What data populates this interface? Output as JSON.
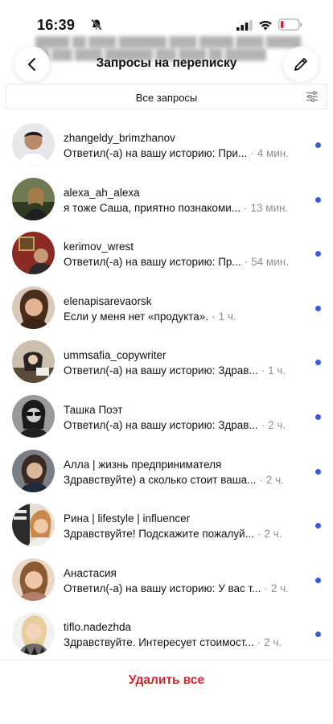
{
  "status_bar": {
    "time": "16:39"
  },
  "header": {
    "title": "Запросы на переписку"
  },
  "filter": {
    "label": "Все запросы"
  },
  "requests": [
    {
      "username": "zhangeldy_brimzhanov",
      "preview": "Ответил(-а) на вашу историю: При...",
      "time": "4 мин.",
      "unread": true
    },
    {
      "username": "alexa_ah_alexa",
      "preview": "я тоже Саша, приятно познакоми...",
      "time": "13 мин.",
      "unread": true
    },
    {
      "username": "kerimov_wrest",
      "preview": "Ответил(-а) на вашу историю: Пр...",
      "time": "54 мин.",
      "unread": true
    },
    {
      "username": "elenapisarevaorsk",
      "preview": "Если у меня нет «продукта».",
      "time": "1 ч.",
      "unread": true
    },
    {
      "username": "ummsafia_copywriter",
      "preview": "Ответил(-а) на вашу историю: Здрав...",
      "time": "1 ч.",
      "unread": true
    },
    {
      "username": "Ташка Поэт",
      "preview": "Ответил(-а) на вашу историю: Здрав...",
      "time": "2 ч.",
      "unread": true
    },
    {
      "username": "Алла | жизнь предпринимателя",
      "preview": "Здравствуйте) а сколько стоит ваша...",
      "time": "2 ч.",
      "unread": true
    },
    {
      "username": "Рина | lifestyle | influencer",
      "preview": "Здравствуйте! Подскажите пожалуй...",
      "time": "2 ч.",
      "unread": true
    },
    {
      "username": "Анастасия",
      "preview": "Ответил(-а) на вашу историю: У вас т...",
      "time": "2 ч.",
      "unread": true
    },
    {
      "username": "tiflo.nadezhda",
      "preview": "Здравствуйте. Интересует стоимост...",
      "time": "2 ч.",
      "unread": true
    }
  ],
  "footer": {
    "delete_all": "Удалить все"
  },
  "colors": {
    "accent_blue": "#3b5bdb",
    "destructive_red": "#e0222e",
    "muted": "#8e8e8e"
  },
  "icons": {
    "status": [
      "bell-off-icon",
      "signal-icon",
      "wifi-icon",
      "battery-icon"
    ],
    "header": [
      "back-arrow-icon",
      "edit-pencil-icon"
    ],
    "filter": "filter-sliders-icon"
  }
}
